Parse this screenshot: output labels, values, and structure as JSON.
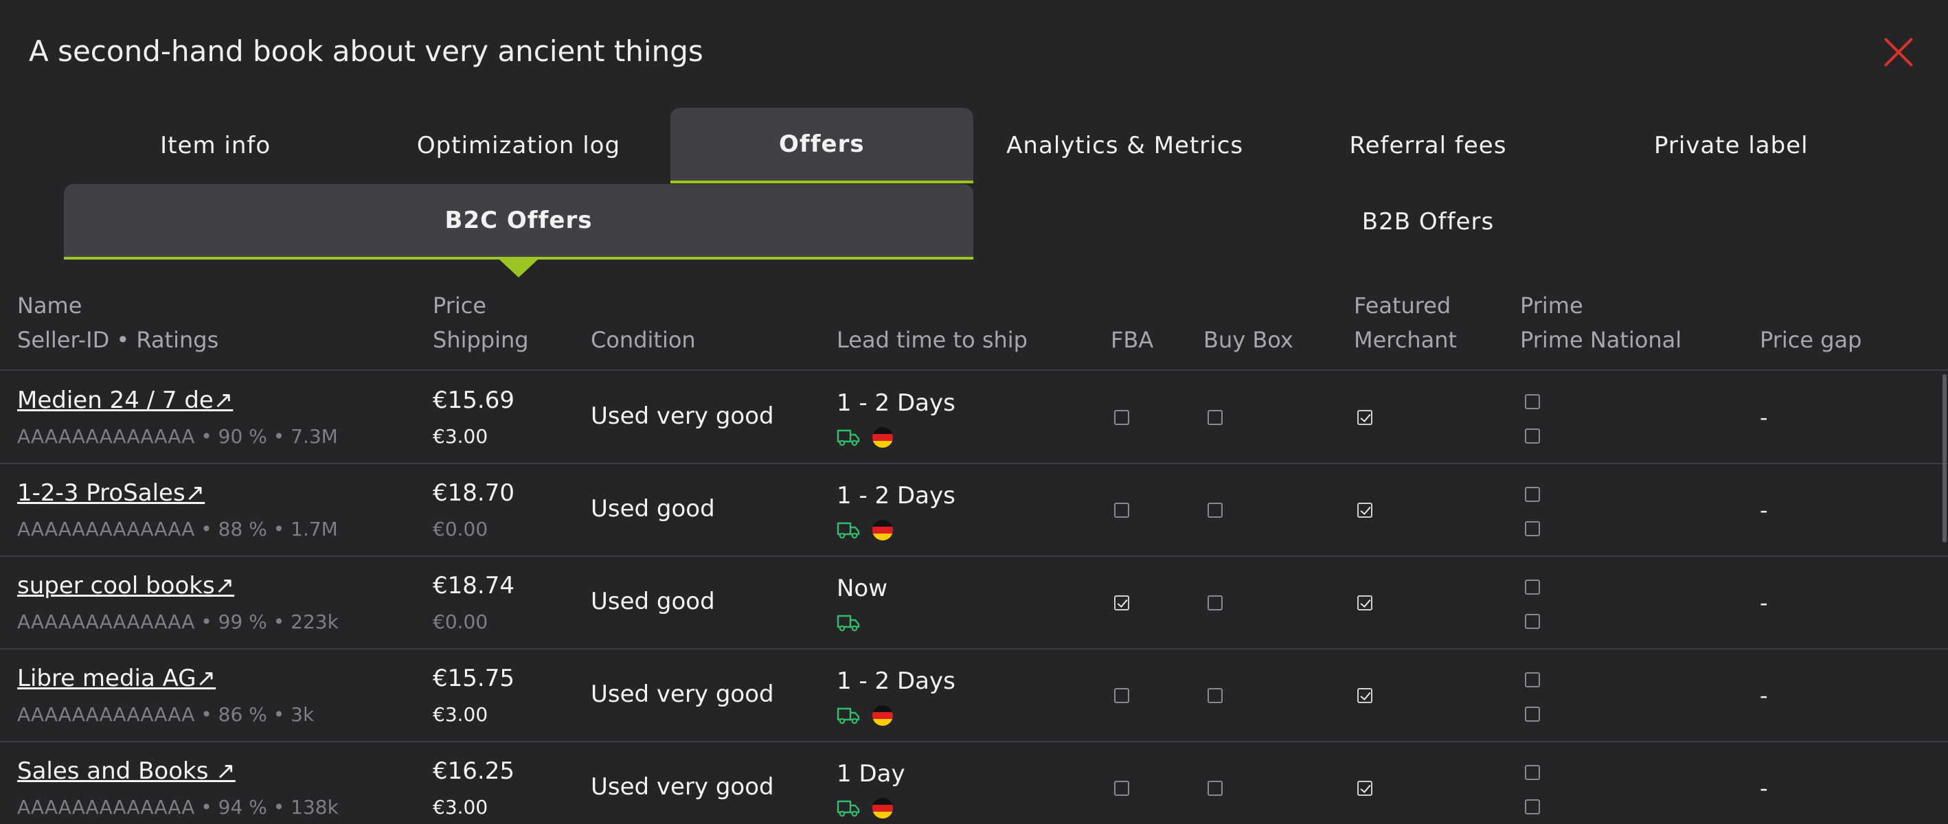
{
  "window": {
    "title": "A second-hand book about very ancient things"
  },
  "tabs": [
    {
      "label": "Item info"
    },
    {
      "label": "Optimization log"
    },
    {
      "label": "Offers"
    },
    {
      "label": "Analytics & Metrics"
    },
    {
      "label": "Referral fees"
    },
    {
      "label": "Private label"
    }
  ],
  "subtabs": [
    {
      "label": "B2C Offers"
    },
    {
      "label": "B2B Offers"
    }
  ],
  "columns": {
    "name": "Name",
    "seller": "Seller-ID • Ratings",
    "price": "Price",
    "shipping": "Shipping",
    "condition": "Condition",
    "lead": "Lead time to ship",
    "fba": "FBA",
    "buybox": "Buy Box",
    "featured": "Featured",
    "merchant": "Merchant",
    "prime": "Prime",
    "prime_national": "Prime National",
    "price_gap": "Price gap"
  },
  "colors": {
    "accent": "#9bc522",
    "close": "#d9322b",
    "truck": "#2fbf6a"
  },
  "rows": [
    {
      "name": "Medien 24 / 7 de↗",
      "meta": "AAAAAAAAAAAAA • 90 % • 7.3M",
      "price": "€15.69",
      "shipping": "€3.00",
      "shipping_zero": false,
      "condition": "Used very good",
      "lead": "1 - 2 Days",
      "flag": true,
      "fba": false,
      "buybox": false,
      "featured": true,
      "prime": false,
      "prime_national": false,
      "gap": "-"
    },
    {
      "name": "1-2-3 ProSales↗",
      "meta": "AAAAAAAAAAAAA • 88 % • 1.7M",
      "price": "€18.70",
      "shipping": "€0.00",
      "shipping_zero": true,
      "condition": "Used good",
      "lead": "1 - 2 Days",
      "flag": true,
      "fba": false,
      "buybox": false,
      "featured": true,
      "prime": false,
      "prime_national": false,
      "gap": "-"
    },
    {
      "name": "super cool books↗",
      "meta": "AAAAAAAAAAAAA • 99 % • 223k",
      "price": "€18.74",
      "shipping": "€0.00",
      "shipping_zero": true,
      "condition": "Used good",
      "lead": "Now",
      "flag": false,
      "fba": true,
      "buybox": false,
      "featured": true,
      "prime": false,
      "prime_national": false,
      "gap": "-"
    },
    {
      "name": "Libre media AG↗",
      "meta": "AAAAAAAAAAAAA • 86 % • 3k",
      "price": "€15.75",
      "shipping": "€3.00",
      "shipping_zero": false,
      "condition": "Used very good",
      "lead": "1 - 2 Days",
      "flag": true,
      "fba": false,
      "buybox": false,
      "featured": true,
      "prime": false,
      "prime_national": false,
      "gap": "-"
    },
    {
      "name": "Sales and Books ↗",
      "meta": "AAAAAAAAAAAAA • 94 % • 138k",
      "price": "€16.25",
      "shipping": "€3.00",
      "shipping_zero": false,
      "condition": "Used very good",
      "lead": "1 Day",
      "flag": true,
      "fba": false,
      "buybox": false,
      "featured": true,
      "prime": false,
      "prime_national": false,
      "gap": "-"
    }
  ]
}
